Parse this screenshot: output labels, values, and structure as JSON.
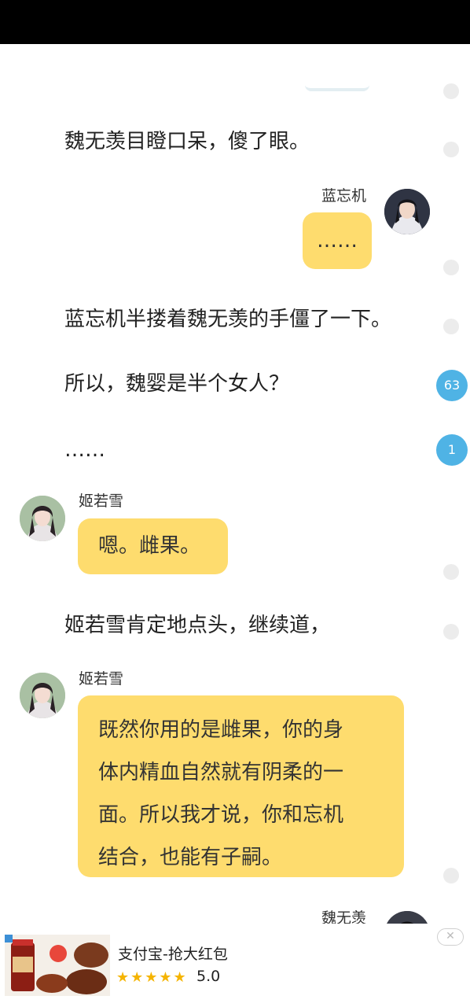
{
  "story": {
    "line1": "魏无羡目瞪口呆，傻了眼。",
    "speaker1": "蓝忘机",
    "bubble1": "……",
    "line2": "蓝忘机半搂着魏无羡的手僵了一下。",
    "line3": "所以，魏婴是半个女人？",
    "line4": "……",
    "speaker2": "姬若雪",
    "bubble2": "嗯。雌果。",
    "line5": "姬若雪肯定地点头，继续道，",
    "speaker3": "姬若雪",
    "bubble3_lines": [
      "既然你用的是雌果，你的身",
      "体内精血自然就有阴柔的一",
      "面。所以我才说，你和忘机",
      "结合，也能有子嗣。"
    ],
    "speaker4": "魏无羡"
  },
  "comments": {
    "count_a": "63",
    "count_b": "1"
  },
  "ad": {
    "title": "支付宝-抢大红包",
    "stars": "★★★★★",
    "rating": "5.0",
    "close": "✕"
  },
  "colors": {
    "bubble": "#fedc6e",
    "badge": "#4fb3e5",
    "star": "#f5b400"
  }
}
